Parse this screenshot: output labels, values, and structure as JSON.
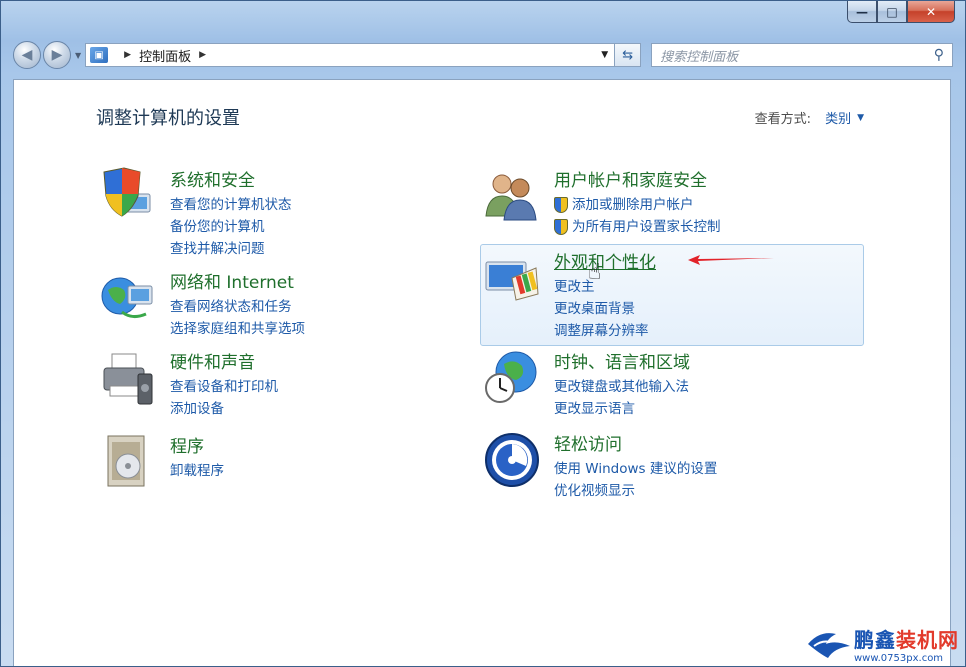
{
  "window": {
    "caption": {
      "minimize": "—",
      "maximize": "□",
      "close": "✕"
    }
  },
  "nav": {
    "back_icon": "back-arrow-icon",
    "forward_icon": "forward-arrow-icon",
    "breadcrumb": "控制面板",
    "search_placeholder": "搜索控制面板"
  },
  "header": {
    "title": "调整计算机的设置",
    "view_label": "查看方式:",
    "view_value": "类别"
  },
  "categories": [
    {
      "title": "系统和安全",
      "icon": "shield-computer-icon",
      "links": [
        "查看您的计算机状态",
        "备份您的计算机",
        "查找并解决问题"
      ]
    },
    {
      "title": "网络和 Internet",
      "icon": "network-globe-icon",
      "links": [
        "查看网络状态和任务",
        "选择家庭组和共享选项"
      ]
    },
    {
      "title": "硬件和声音",
      "icon": "printer-icon",
      "links": [
        "查看设备和打印机",
        "添加设备"
      ]
    },
    {
      "title": "程序",
      "icon": "programs-icon",
      "links": [
        "卸载程序"
      ]
    },
    {
      "title": "用户帐户和家庭安全",
      "icon": "users-icon",
      "links": [
        "添加或删除用户帐户",
        "为所有用户设置家长控制"
      ]
    },
    {
      "title": "外观和个性化",
      "icon": "monitor-palette-icon",
      "links": [
        "更改主",
        "更改桌面背景",
        "调整屏幕分辨率"
      ]
    },
    {
      "title": "时钟、语言和区域",
      "icon": "clock-globe-icon",
      "links": [
        "更改键盘或其他输入法",
        "更改显示语言"
      ]
    },
    {
      "title": "轻松访问",
      "icon": "ease-of-access-icon",
      "links": [
        "使用 Windows 建议的设置",
        "优化视频显示"
      ]
    }
  ],
  "watermark": {
    "title_part1": "鹏鑫",
    "title_part2": "装机网",
    "url": "www.0753px.com"
  },
  "colors": {
    "category_title": "#1f6f2c",
    "link": "#1e5aa8",
    "annotation_arrow": "#e2232a"
  }
}
